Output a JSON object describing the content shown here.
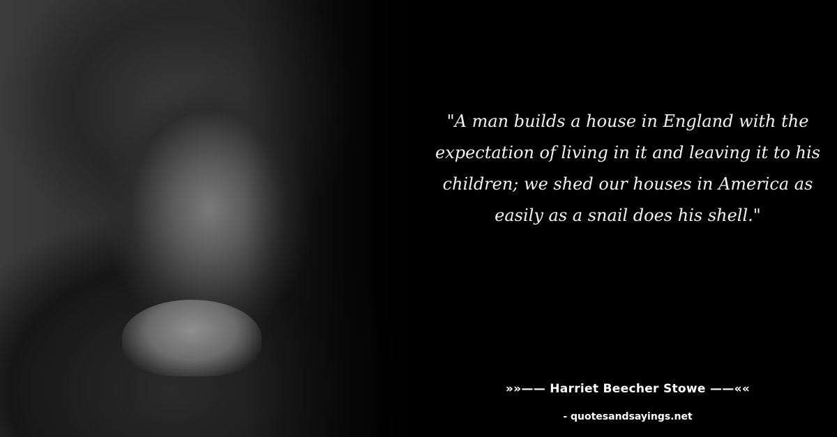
{
  "quote": {
    "text": "\"A man builds a house in England with the expectation of living in it and leaving it to his children; we shed our houses in America as easily as a snail does his shell.\""
  },
  "author": {
    "text": "»»—— Harriet Beecher Stowe ——««"
  },
  "source": {
    "text": "- quotesandsayings.net"
  },
  "colors": {
    "background": "#000000",
    "text": "#f2f2f2"
  }
}
